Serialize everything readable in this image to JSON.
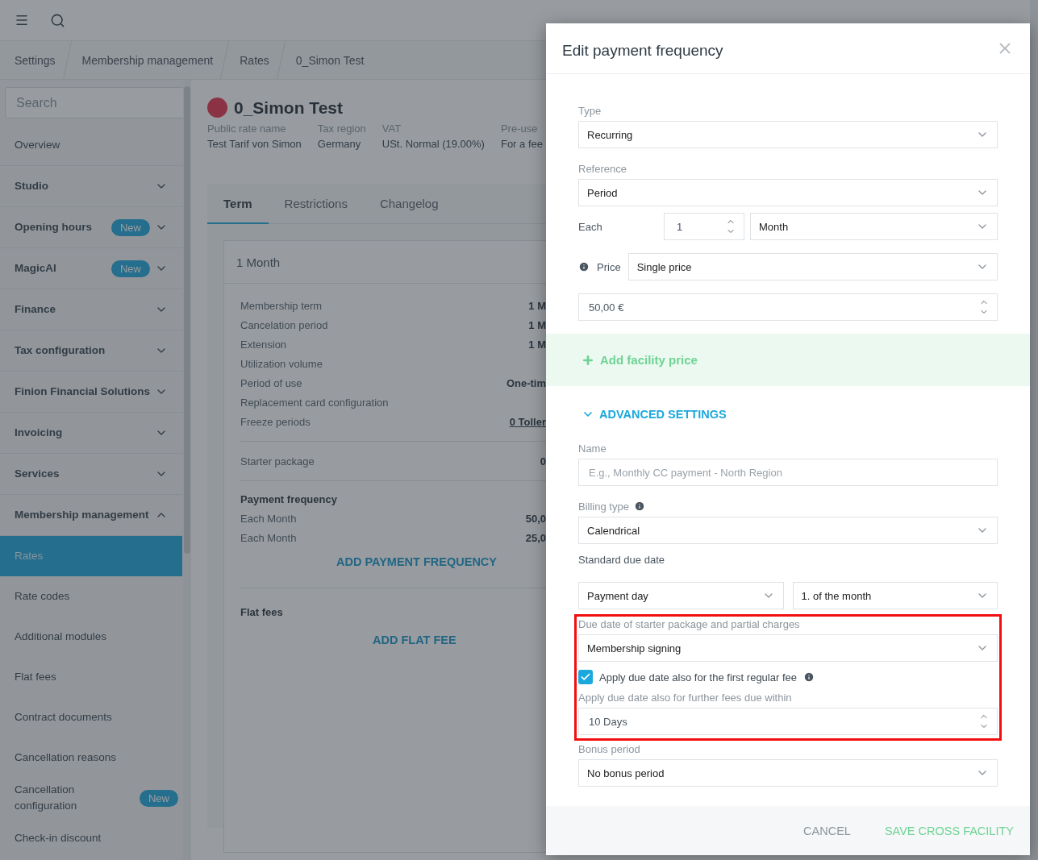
{
  "breadcrumbs": [
    "Settings",
    "Membership management",
    "Rates",
    "0_Simon Test"
  ],
  "sidebar": {
    "search": {
      "placeholder": "Search"
    },
    "items": [
      {
        "label": "Overview",
        "kind": "link",
        "selected": false
      },
      {
        "label": "Studio",
        "kind": "group",
        "expanded": false,
        "selected": false
      },
      {
        "label": "Opening hours",
        "kind": "group",
        "expanded": false,
        "badge": "New",
        "selected": false
      },
      {
        "label": "MagicAI",
        "kind": "group",
        "expanded": false,
        "badge": "New",
        "selected": false
      },
      {
        "label": "Finance",
        "kind": "group",
        "expanded": false,
        "selected": false
      },
      {
        "label": "Tax configuration",
        "kind": "group",
        "expanded": false,
        "selected": false
      },
      {
        "label": "Finion Financial Solutions",
        "kind": "group",
        "expanded": false,
        "selected": false
      },
      {
        "label": "Invoicing",
        "kind": "group",
        "expanded": false,
        "selected": false
      },
      {
        "label": "Services",
        "kind": "group",
        "expanded": false,
        "selected": false
      },
      {
        "label": "Membership management",
        "kind": "group",
        "expanded": true,
        "selected": false
      },
      {
        "label": "Rates",
        "kind": "link",
        "selected": true
      },
      {
        "label": "Rate codes",
        "kind": "link",
        "selected": false
      },
      {
        "label": "Additional modules",
        "kind": "link",
        "selected": false
      },
      {
        "label": "Flat fees",
        "kind": "link",
        "selected": false
      },
      {
        "label": "Contract documents",
        "kind": "link",
        "selected": false
      },
      {
        "label": "Cancellation reasons",
        "kind": "link",
        "selected": false
      },
      {
        "label": "Cancellation configuration",
        "kind": "link",
        "badge": "New",
        "selected": false
      },
      {
        "label": "Check-in discount",
        "kind": "link",
        "selected": false
      }
    ]
  },
  "rate": {
    "title": "0_Simon Test",
    "color": "#8b3344",
    "meta": [
      {
        "label": "Public rate name",
        "value": "Test Tarif von Simon"
      },
      {
        "label": "Tax region",
        "value": "Germany"
      },
      {
        "label": "VAT",
        "value": "USt. Normal (19.00%)"
      },
      {
        "label": "Pre-use",
        "value": "For a fee"
      }
    ]
  },
  "tabs": [
    {
      "label": "Term",
      "selected": true
    },
    {
      "label": "Restrictions",
      "selected": false
    },
    {
      "label": "Changelog",
      "selected": false
    }
  ],
  "card": {
    "title": "1 Month",
    "terms": [
      {
        "label": "Membership term",
        "value": "1 M",
        "kind": "text"
      },
      {
        "label": "Cancelation period",
        "value": "1 M",
        "kind": "text"
      },
      {
        "label": "Extension",
        "value": "1 M",
        "kind": "text"
      },
      {
        "label": "Utilization volume"
      },
      {
        "label": "Period of use",
        "value": "One-tim",
        "kind": "text"
      },
      {
        "label": "Replacement card configuration"
      },
      {
        "label": "Freeze periods",
        "value": "0 Toller",
        "kind": "link"
      }
    ],
    "starter": {
      "label": "Starter package",
      "value": "0"
    },
    "payment": {
      "heading": "Payment frequency",
      "rows": [
        {
          "label": "Each Month",
          "value": "50,0"
        },
        {
          "label": "Each Month",
          "value": "25,0"
        }
      ],
      "action": "ADD PAYMENT FREQUENCY"
    },
    "flat_fees": {
      "heading": "Flat fees",
      "action": "ADD FLAT FEE"
    }
  },
  "modal": {
    "title": "Edit payment frequency",
    "type": {
      "label": "Type",
      "value": "Recurring"
    },
    "reference": {
      "label": "Reference",
      "value": "Period"
    },
    "each": {
      "label": "Each",
      "count": "1",
      "unit": "Month"
    },
    "price": {
      "label": "Price",
      "mode": "Single price",
      "amount": "50,00 €"
    },
    "add_facility_price": "Add facility price",
    "advanced": {
      "label": "ADVANCED SETTINGS",
      "expanded": true
    },
    "name": {
      "label": "Name",
      "placeholder": "E.g., Monthly CC payment - North Region"
    },
    "billing_type": {
      "label": "Billing type",
      "value": "Calendrical"
    },
    "standard_due_date": {
      "label": "Standard due date",
      "day_type": "Payment day",
      "day": "1. of the month"
    },
    "starter_due": {
      "label": "Due date of starter package and partial charges",
      "value": "Membership signing"
    },
    "apply_first": {
      "label": "Apply due date also for the first regular fee",
      "checked": true
    },
    "further_fees": {
      "label": "Apply due date also for further fees due within",
      "value": "10 Days"
    },
    "bonus": {
      "label": "Bonus period",
      "value": "No bonus period"
    },
    "cancel": "CANCEL",
    "save": "SAVE CROSS FACILITY"
  }
}
